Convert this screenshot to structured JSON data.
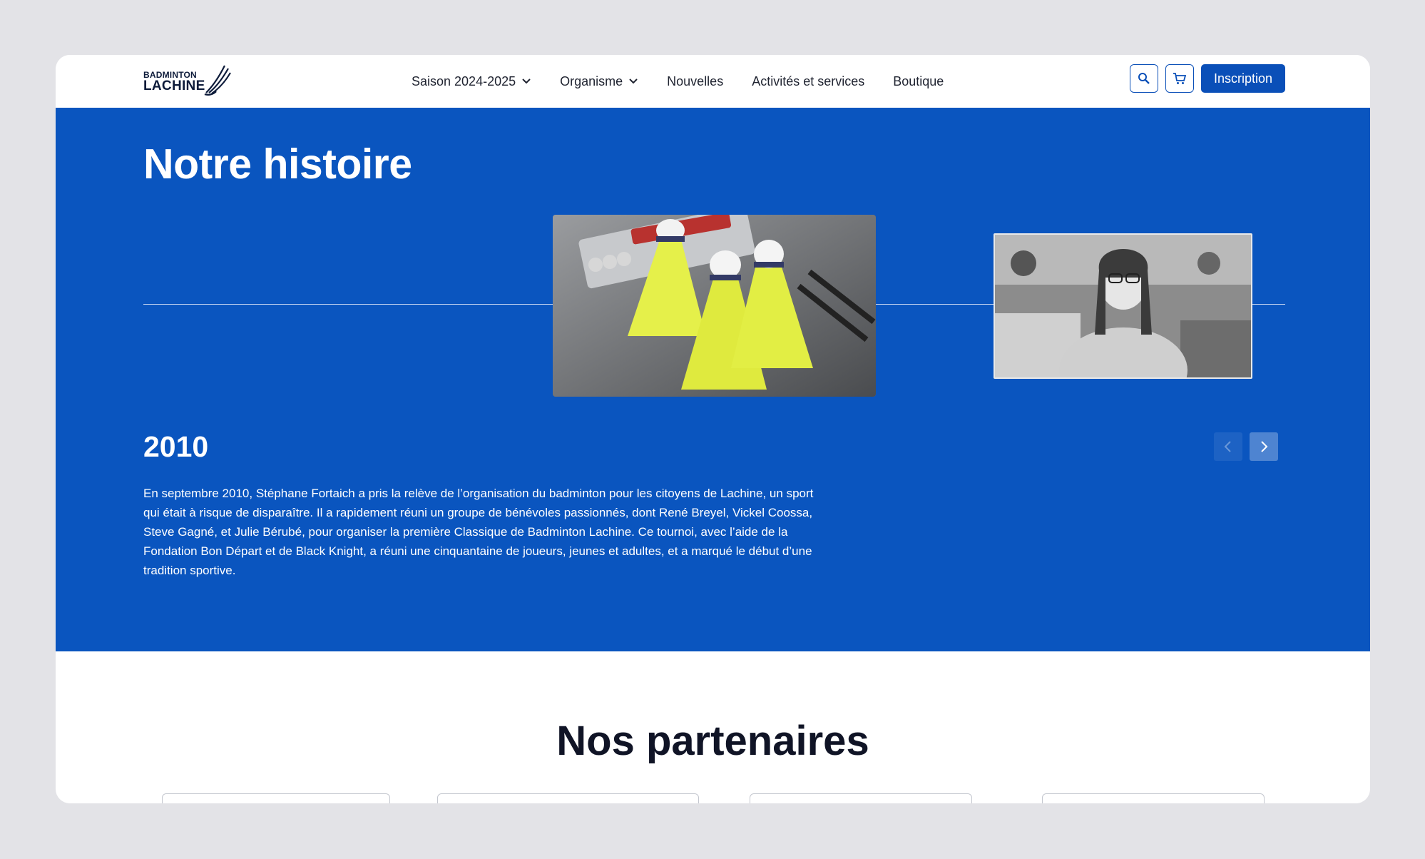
{
  "brand": {
    "logo_line1": "BADMINTON",
    "logo_line2": "LACHINE",
    "primary_color": "#0a55bf",
    "button_color": "#0a4fb8"
  },
  "nav": {
    "items": [
      {
        "label": "Saison 2024-2025",
        "has_dropdown": true
      },
      {
        "label": "Organisme",
        "has_dropdown": true
      },
      {
        "label": "Nouvelles",
        "has_dropdown": false
      },
      {
        "label": "Activités et services",
        "has_dropdown": false
      },
      {
        "label": "Boutique",
        "has_dropdown": false
      }
    ],
    "search_icon": "search-icon",
    "cart_icon": "cart-icon",
    "cta_label": "Inscription"
  },
  "hero": {
    "title": "Notre histoire",
    "year": "2010",
    "text": "En septembre 2010, Stéphane Fortaich a pris la relève de l’organisation du badminton pour les citoyens de Lachine, un sport qui était à risque de disparaître. Il a rapidement réuni un groupe de bénévoles passionnés, dont René Breyel, Vickel Coossa, Steve Gagné, et Julie Bérubé, pour organiser la première Classique de Badminton Lachine. Ce tournoi, avec l’aide de la Fondation Bon Départ et de Black Knight, a réuni une cinquantaine de joueurs, jeunes et adultes, et a marqué le début d’une tradition sportive."
  },
  "partners": {
    "title": "Nos partenaires"
  }
}
